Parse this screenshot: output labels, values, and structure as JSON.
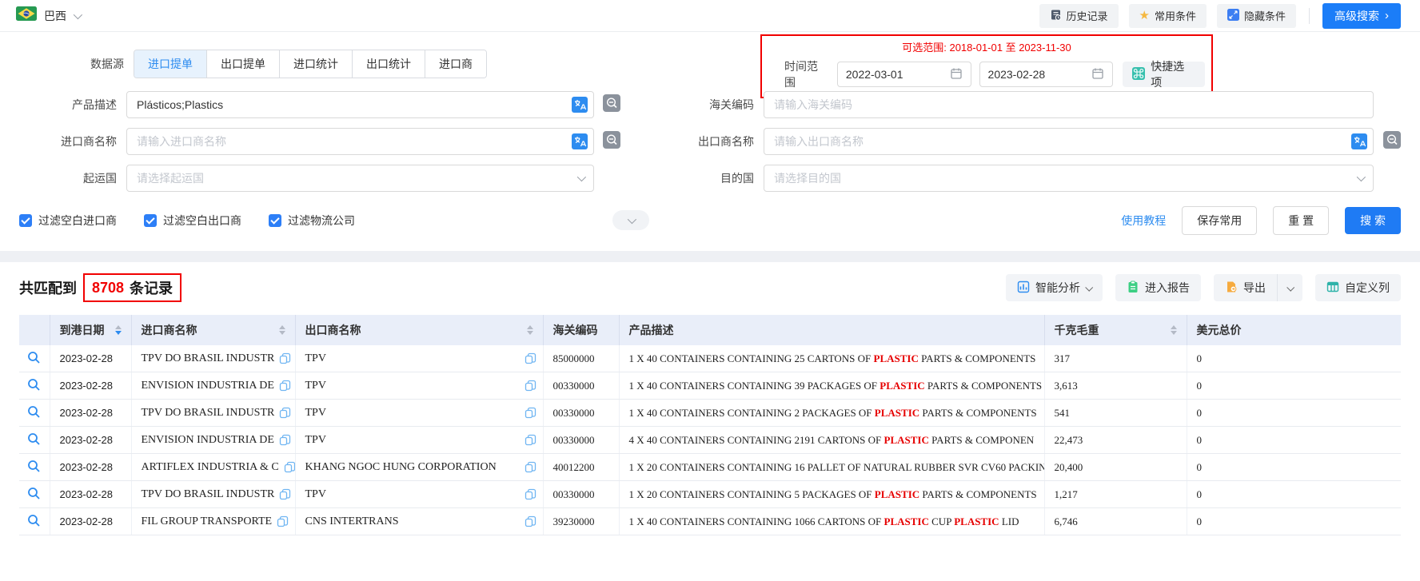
{
  "topbar": {
    "country": "巴西",
    "history": "历史记录",
    "favorites": "常用条件",
    "hide_conditions": "隐藏条件",
    "advanced_search": "高级搜索",
    "advanced_arrow": "›"
  },
  "search": {
    "datasource_label": "数据源",
    "tabs": [
      {
        "label": "进口提单",
        "active": true
      },
      {
        "label": "出口提单",
        "active": false
      },
      {
        "label": "进口统计",
        "active": false
      },
      {
        "label": "出口统计",
        "active": false
      },
      {
        "label": "进口商",
        "active": false
      }
    ],
    "time": {
      "available_range": "可选范围: 2018-01-01 至 2023-11-30",
      "label": "时间范围",
      "start_date": "2022-03-01",
      "end_date": "2023-02-28",
      "quick_options": "快捷选项"
    },
    "fields": {
      "product_desc": {
        "label": "产品描述",
        "value": "Plásticos;Plastics"
      },
      "hs_code": {
        "label": "海关编码",
        "placeholder": "请输入海关编码"
      },
      "importer": {
        "label": "进口商名称",
        "placeholder": "请输入进口商名称"
      },
      "exporter": {
        "label": "出口商名称",
        "placeholder": "请输入出口商名称"
      },
      "origin": {
        "label": "起运国",
        "placeholder": "请选择起运国"
      },
      "destination": {
        "label": "目的国",
        "placeholder": "请选择目的国"
      }
    },
    "filters": [
      {
        "label": "过滤空白进口商",
        "checked": true
      },
      {
        "label": "过滤空白出口商",
        "checked": true
      },
      {
        "label": "过滤物流公司",
        "checked": true
      }
    ],
    "actions": {
      "tutorial": "使用教程",
      "save": "保存常用",
      "reset": "重 置",
      "submit": "搜 索"
    }
  },
  "results": {
    "count_prefix": "共匹配到",
    "count": "8708",
    "count_suffix": "条记录",
    "toolbar": {
      "analysis": "智能分析",
      "report": "进入报告",
      "export": "导出",
      "custom_columns": "自定义列"
    },
    "highlight_term": "PLASTIC",
    "highlight_color": "#e60000",
    "annotation_color": "#f10000"
  },
  "table": {
    "columns": [
      {
        "label": "到港日期",
        "sortable": true,
        "sorted": "desc"
      },
      {
        "label": "进口商名称",
        "sortable": true,
        "sorted": null
      },
      {
        "label": "出口商名称",
        "sortable": true,
        "sorted": null
      },
      {
        "label": "海关编码",
        "sortable": false,
        "sorted": null
      },
      {
        "label": "产品描述",
        "sortable": false,
        "sorted": null
      },
      {
        "label": "千克毛重",
        "sortable": true,
        "sorted": null
      },
      {
        "label": "美元总价",
        "sortable": false,
        "sorted": null
      }
    ],
    "rows": [
      {
        "date": "2023-02-28",
        "importer": "TPV DO BRASIL INDUSTR",
        "exporter": "TPV",
        "hs_code": "85000000",
        "description": "1 X 40 CONTAINERS CONTAINING 25 CARTONS OF PLASTIC PARTS & COMPONENTS",
        "weight_kg": "317",
        "value_usd": "0"
      },
      {
        "date": "2023-02-28",
        "importer": "ENVISION INDUSTRIA DE",
        "exporter": "TPV",
        "hs_code": "00330000",
        "description": "1 X 40 CONTAINERS CONTAINING 39 PACKAGES OF PLASTIC PARTS & COMPONENTS",
        "weight_kg": "3,613",
        "value_usd": "0"
      },
      {
        "date": "2023-02-28",
        "importer": "TPV DO BRASIL INDUSTR",
        "exporter": "TPV",
        "hs_code": "00330000",
        "description": "1 X 40 CONTAINERS CONTAINING 2 PACKAGES OF PLASTIC PARTS & COMPONENTS",
        "weight_kg": "541",
        "value_usd": "0"
      },
      {
        "date": "2023-02-28",
        "importer": "ENVISION INDUSTRIA DE",
        "exporter": "TPV",
        "hs_code": "00330000",
        "description": "4 X 40 CONTAINERS CONTAINING 2191 CARTONS OF PLASTIC PARTS & COMPONEN",
        "weight_kg": "22,473",
        "value_usd": "0"
      },
      {
        "date": "2023-02-28",
        "importer": "ARTIFLEX INDUSTRIA & C",
        "exporter": "KHANG NGOC HUNG CORPORATION",
        "hs_code": "40012200",
        "description": "1 X 20 CONTAINERS CONTAINING 16 PALLET OF NATURAL RUBBER SVR CV60 PACKIN",
        "weight_kg": "20,400",
        "value_usd": "0"
      },
      {
        "date": "2023-02-28",
        "importer": "TPV DO BRASIL INDUSTR",
        "exporter": "TPV",
        "hs_code": "00330000",
        "description": "1 X 20 CONTAINERS CONTAINING 5 PACKAGES OF PLASTIC PARTS & COMPONENTS",
        "weight_kg": "1,217",
        "value_usd": "0"
      },
      {
        "date": "2023-02-28",
        "importer": "FIL GROUP TRANSPORTE",
        "exporter": "CNS INTERTRANS",
        "hs_code": "39230000",
        "description": "1 X 40 CONTAINERS CONTAINING 1066 CARTONS OF PLASTIC CUP PLASTIC LID",
        "weight_kg": "6,746",
        "value_usd": "0"
      }
    ]
  }
}
